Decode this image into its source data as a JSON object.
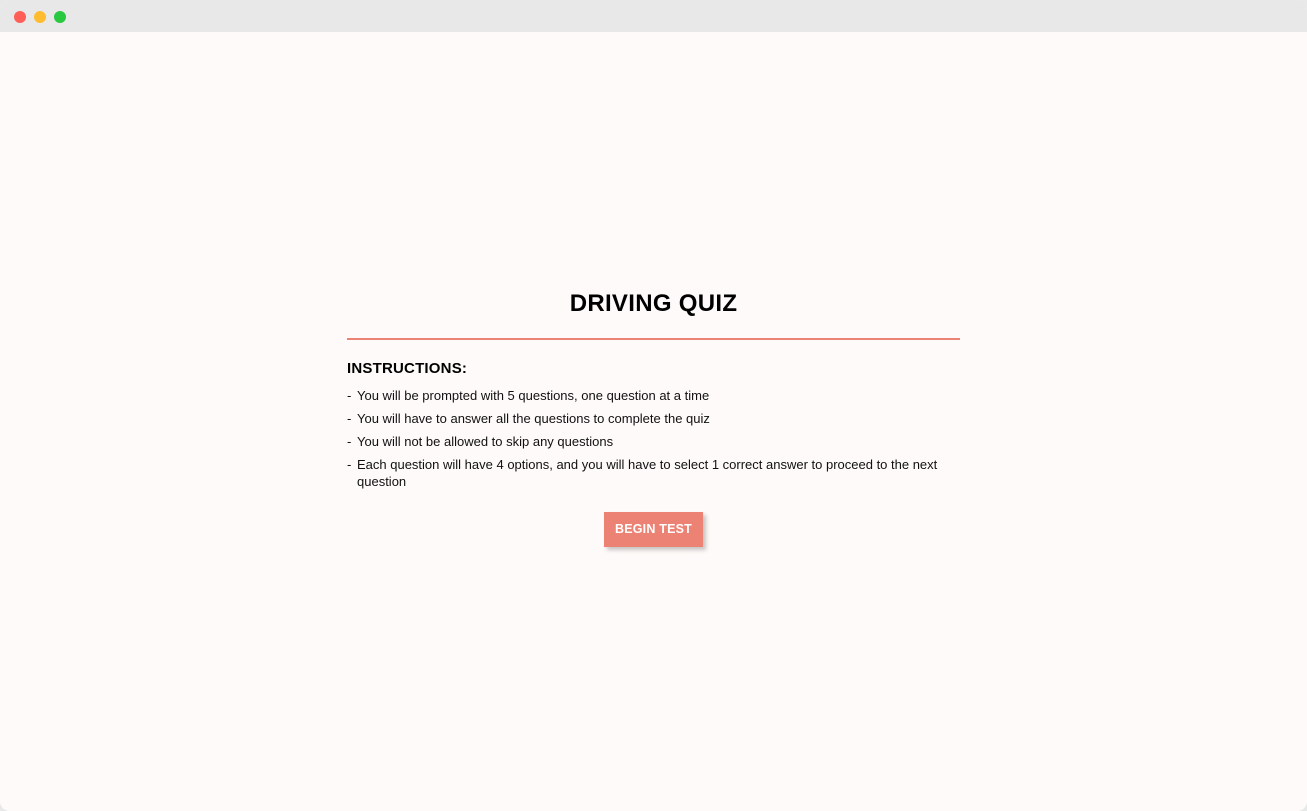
{
  "window": {
    "controls": [
      {
        "name": "close",
        "color": "#fe5f57"
      },
      {
        "name": "minimize",
        "color": "#febc2e"
      },
      {
        "name": "maximize",
        "color": "#28c840"
      }
    ]
  },
  "quiz": {
    "title": "DRIVING QUIZ",
    "accent_color": "#ec8274",
    "instructions_heading": "INSTRUCTIONS:",
    "instructions": [
      "You will be prompted with 5 questions, one question at a time",
      "You will have to answer all the questions to complete the quiz",
      "You will not be allowed to skip any questions",
      "Each question will have 4 options, and you will have to select 1 correct answer to proceed to the next question"
    ],
    "bullet": "-",
    "begin_button_label": "BEGIN TEST"
  }
}
